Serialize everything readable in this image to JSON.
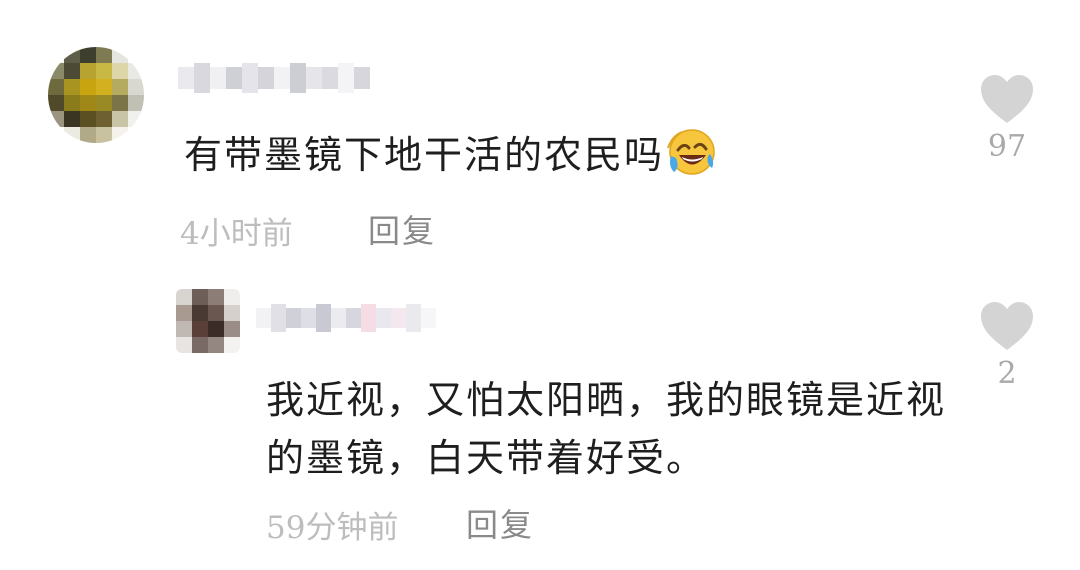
{
  "comments": [
    {
      "text": "有带墨镜下地干活的农民吗",
      "emoji": "laughing-with-tears-emoji",
      "time": "4小时前",
      "reply_label": "回复",
      "likes": "97",
      "avatar_colors": [
        "#f4f4f2",
        "#5e5e48",
        "#3e3e2e",
        "#7e7a52",
        "#e6e6e0",
        "#ffffff",
        "#8a8a6a",
        "#4c4a34",
        "#b8a230",
        "#c8b844",
        "#dcd6a8",
        "#e8e8e4",
        "#6e6a3e",
        "#a89420",
        "#c8a410",
        "#d2b020",
        "#b4aa60",
        "#d8d8d0",
        "#504a2a",
        "#8a7c1a",
        "#a08818",
        "#9a8a26",
        "#7a7448",
        "#c0c0b4",
        "#9a9480",
        "#3a3422",
        "#5a5022",
        "#6e6030",
        "#c8c4a8",
        "#f0f0ec",
        "#ffffff",
        "#ecebe2",
        "#b0aa88",
        "#c8c2a0",
        "#f4f2ea",
        "#ffffff"
      ],
      "name_blur_colors": [
        "#e9e9ee",
        "#d8d8de",
        "#f0f0f3",
        "#cfcfd6",
        "#e4e4ea",
        "#d4d4da",
        "#f2f2f4",
        "#cdced4",
        "#e6e6ea",
        "#dadae0",
        "#f4f4f6",
        "#d6d6dc"
      ]
    },
    {
      "text": "我近视，又怕太阳晒，我的眼镜是近视的墨镜，白天带着好受。",
      "time": "59分钟前",
      "reply_label": "回复",
      "likes": "2",
      "avatar_colors": [
        "#d8d4d0",
        "#6e5e58",
        "#8c7e76",
        "#f0eeec",
        "#a89a90",
        "#4a3a34",
        "#6a5850",
        "#d6d0cc",
        "#c0b8b2",
        "#5a3e38",
        "#3c2c28",
        "#9a8c86",
        "#e8e4e2",
        "#7a6a66",
        "#948680",
        "#f4f2f0"
      ],
      "name_blur_colors": [
        "#f2f2f4",
        "#e0e0e6",
        "#cfd0d8",
        "#dedfe6",
        "#c8c9d2",
        "#ececf0",
        "#d6d7de",
        "#f6dce4",
        "#e8e8ee",
        "#f4e8ee",
        "#eaeaee",
        "#f6f6f8"
      ]
    }
  ]
}
